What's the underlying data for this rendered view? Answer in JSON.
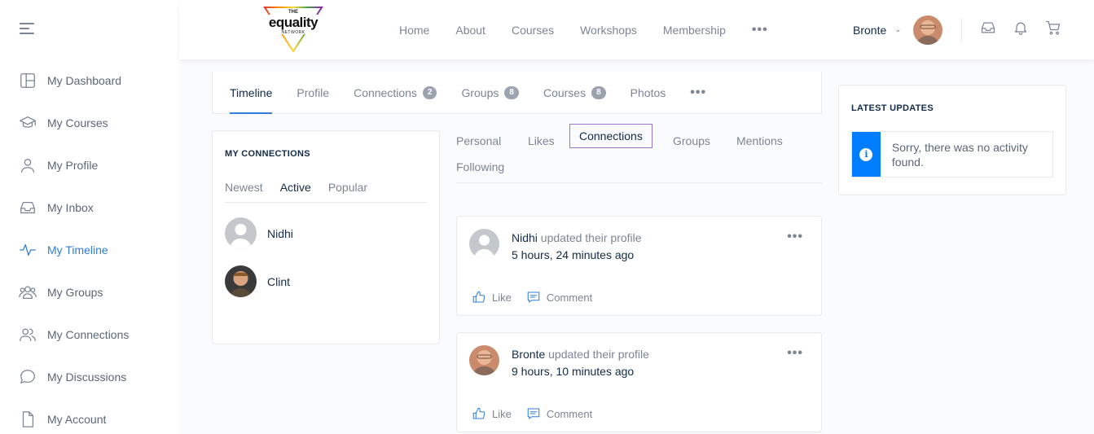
{
  "brand": {
    "logo_lines": [
      "THE",
      "equality",
      "NETWORK"
    ]
  },
  "sidebar": {
    "items": [
      {
        "label": "My Dashboard",
        "icon": "dashboard-icon"
      },
      {
        "label": "My Courses",
        "icon": "graduation-cap-icon"
      },
      {
        "label": "My Profile",
        "icon": "user-icon"
      },
      {
        "label": "My Inbox",
        "icon": "inbox-icon"
      },
      {
        "label": "My Timeline",
        "icon": "activity-icon",
        "active": true
      },
      {
        "label": "My Groups",
        "icon": "groups-icon"
      },
      {
        "label": "My Connections",
        "icon": "connections-icon"
      },
      {
        "label": "My Discussions",
        "icon": "discussions-icon"
      },
      {
        "label": "My Account",
        "icon": "document-icon"
      }
    ]
  },
  "header": {
    "nav": [
      "Home",
      "About",
      "Courses",
      "Workshops",
      "Membership"
    ],
    "more": "•••",
    "user_name": "Bronte",
    "caret": "⌄"
  },
  "profile_tabs": {
    "timeline": "Timeline",
    "profile": "Profile",
    "connections": "Connections",
    "connections_count": "2",
    "groups": "Groups",
    "groups_count": "8",
    "courses": "Courses",
    "courses_count": "8",
    "photos": "Photos",
    "more": "•••"
  },
  "my_connections": {
    "title": "MY CONNECTIONS",
    "tabs": [
      "Newest",
      "Active",
      "Popular"
    ],
    "active_tab": "Active",
    "members": [
      "Nidhi",
      "Clint"
    ]
  },
  "activity_nav": {
    "items": [
      "Personal",
      "Likes",
      "Connections",
      "Groups",
      "Mentions",
      "Following"
    ],
    "active": "Connections"
  },
  "activity": [
    {
      "who": "Nidhi",
      "action": "updated their profile",
      "time": "5 hours, 24 minutes ago",
      "like": "Like",
      "comment": "Comment"
    },
    {
      "who": "Bronte",
      "action": "updated their profile",
      "time": "9 hours, 10 minutes ago",
      "like": "Like",
      "comment": "Comment"
    }
  ],
  "latest_updates": {
    "title": "LATEST UPDATES",
    "message": "Sorry, there was no activity found."
  },
  "colors": {
    "accent": "#2f7dd8",
    "info": "#007cff",
    "focus_outline": "#9b73c9"
  }
}
